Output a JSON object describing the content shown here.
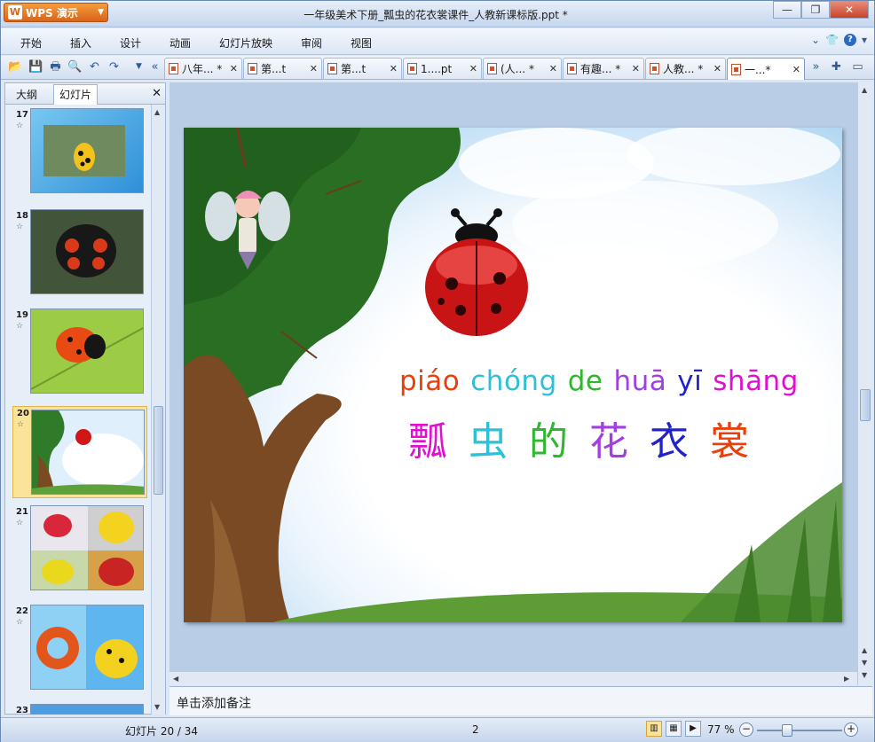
{
  "app": {
    "button_label": "WPS 演示",
    "window_title": "一年级美术下册_瓢虫的花衣裳课件_人教新课标版.ppt *"
  },
  "menu": {
    "items": [
      "开始",
      "插入",
      "设计",
      "动画",
      "幻灯片放映",
      "审阅",
      "视图"
    ]
  },
  "tabs": [
    {
      "label": "八年... *",
      "active": false
    },
    {
      "label": "第...t",
      "active": false
    },
    {
      "label": "第...t",
      "active": false
    },
    {
      "label": "1....pt",
      "active": false
    },
    {
      "label": "(人... *",
      "active": false
    },
    {
      "label": "有趣... *",
      "active": false
    },
    {
      "label": "人教... *",
      "active": false
    },
    {
      "label": "一...*",
      "active": true
    }
  ],
  "left_pane": {
    "tab_outline": "大纲",
    "tab_slides": "幻灯片",
    "thumbs": [
      {
        "num": "17"
      },
      {
        "num": "18"
      },
      {
        "num": "19"
      },
      {
        "num": "20",
        "selected": true
      },
      {
        "num": "21"
      },
      {
        "num": "22"
      },
      {
        "num": "23"
      }
    ],
    "star_glyph": "☆"
  },
  "slide": {
    "pinyin": [
      {
        "text": "piáo",
        "color": "#e8400c"
      },
      {
        "text": "chóng",
        "color": "#2fc0d8"
      },
      {
        "text": "de",
        "color": "#2fb82f"
      },
      {
        "text": "huā",
        "color": "#a040e0"
      },
      {
        "text": "yī",
        "color": "#2222cc"
      },
      {
        "text": "shāng",
        "color": "#e010d0"
      }
    ],
    "hanzi": [
      {
        "text": "瓢",
        "color": "#e010d0"
      },
      {
        "text": "虫",
        "color": "#2fc0d8"
      },
      {
        "text": "的",
        "color": "#2fb82f"
      },
      {
        "text": "花",
        "color": "#a040e0"
      },
      {
        "text": "衣",
        "color": "#2222cc"
      },
      {
        "text": "裳",
        "color": "#e8400c"
      }
    ]
  },
  "notes": {
    "placeholder": "单击添加备注"
  },
  "status": {
    "slide_info": "幻灯片 20 / 34",
    "mid_value": "2",
    "zoom": "77 %"
  }
}
